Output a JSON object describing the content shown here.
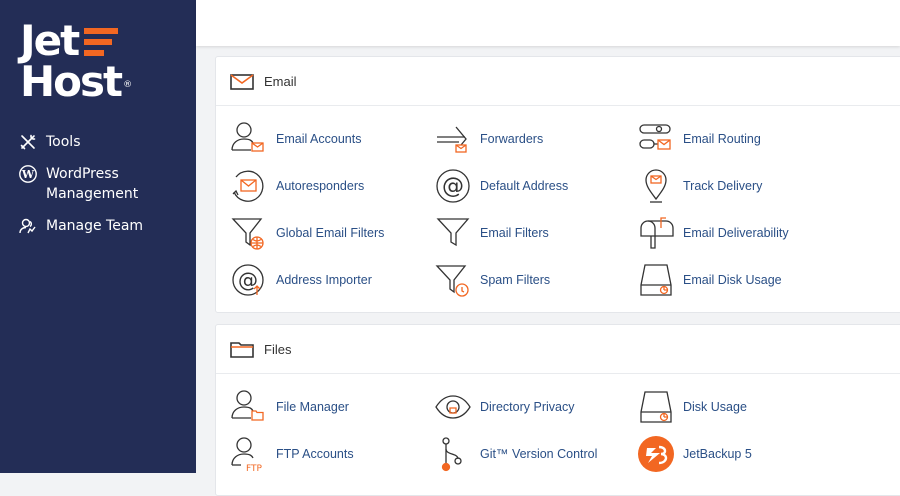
{
  "brand": {
    "line1": "Jet",
    "line2": "Host",
    "reg": "®"
  },
  "sidebar": {
    "items": [
      {
        "label": "Tools",
        "icon": "tools-icon"
      },
      {
        "label": "WordPress Management",
        "icon": "wordpress-icon"
      },
      {
        "label": "Manage Team",
        "icon": "manage-team-icon"
      }
    ]
  },
  "colors": {
    "sidebar": "#232d56",
    "accent": "#f26722",
    "link": "#2a4f86"
  },
  "email": {
    "title": "Email",
    "items": [
      {
        "label": "Email Accounts",
        "icon": "email-accounts-icon"
      },
      {
        "label": "Forwarders",
        "icon": "forwarders-icon"
      },
      {
        "label": "Email Routing",
        "icon": "email-routing-icon"
      },
      {
        "label": "Autoresponders",
        "icon": "autoresponders-icon"
      },
      {
        "label": "Default Address",
        "icon": "default-address-icon"
      },
      {
        "label": "Track Delivery",
        "icon": "track-delivery-icon"
      },
      {
        "label": "Global Email Filters",
        "icon": "global-email-filters-icon"
      },
      {
        "label": "Email Filters",
        "icon": "email-filters-icon"
      },
      {
        "label": "Email Deliverability",
        "icon": "email-deliverability-icon"
      },
      {
        "label": "Address Importer",
        "icon": "address-importer-icon"
      },
      {
        "label": "Spam Filters",
        "icon": "spam-filters-icon"
      },
      {
        "label": "Email Disk Usage",
        "icon": "email-disk-usage-icon"
      }
    ]
  },
  "files": {
    "title": "Files",
    "items": [
      {
        "label": "File Manager",
        "icon": "file-manager-icon"
      },
      {
        "label": "Directory Privacy",
        "icon": "directory-privacy-icon"
      },
      {
        "label": "Disk Usage",
        "icon": "disk-usage-icon"
      },
      {
        "label": "FTP Accounts",
        "icon": "ftp-accounts-icon",
        "badge": "FTP"
      },
      {
        "label": "Git™ Version Control",
        "icon": "git-icon"
      },
      {
        "label": "JetBackup 5",
        "icon": "jetbackup-icon"
      }
    ]
  }
}
